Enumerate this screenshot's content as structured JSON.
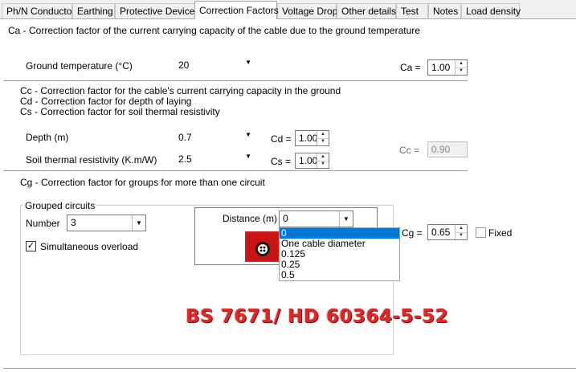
{
  "tabs": [
    "Ph/N Conductor",
    "Earthing",
    "Protective Devices",
    "Correction Factors",
    "Voltage Drop",
    "Other details",
    "Test",
    "Notes",
    "Load density"
  ],
  "active_tab": "Correction Factors",
  "ca_section": {
    "description": "Ca - Correction factor of the current carrying capacity of the cable due to the ground temperature",
    "ground_temp_label": "Ground temperature (°C)",
    "ground_temp_value": "20",
    "ca_label": "Ca =",
    "ca_value": "1.00"
  },
  "cc_section": {
    "desc_cc": "Cc - Correction factor for the cable's current carrying capacity in the ground",
    "desc_cd": "Cd - Correction factor for depth of laying",
    "desc_cs": "Cs - Correction factor for soil thermal resistivity",
    "depth_label": "Depth (m)",
    "depth_value": "0.7",
    "cd_label": "Cd =",
    "cd_value": "1.00",
    "soil_label": "Soil thermal resistivity (K.m/W)",
    "soil_value": "2.5",
    "cs_label": "Cs =",
    "cs_value": "1.00",
    "cc_label": "Cc =",
    "cc_value": "0.90"
  },
  "cg_section": {
    "description": "Cg - Correction factor for groups for more than one circuit",
    "group_title": "Grouped circuits",
    "number_label": "Number",
    "number_value": "3",
    "simultaneous_label": "Simultaneous overload",
    "simultaneous_checked": true,
    "distance_label": "Distance (m)",
    "distance_value": "0",
    "distance_options": [
      "0",
      "One cable diameter",
      "0.125",
      "0.25",
      "0.5"
    ],
    "cg_label": "Cg =",
    "cg_value": "0.65",
    "fixed_label": "Fixed",
    "fixed_checked": false
  },
  "watermark": "BS 7671/ HD 60364-5-52",
  "colors": {
    "selection": "#0078d7",
    "watermark": "#e02828",
    "cable_image": "#d41a1a"
  }
}
